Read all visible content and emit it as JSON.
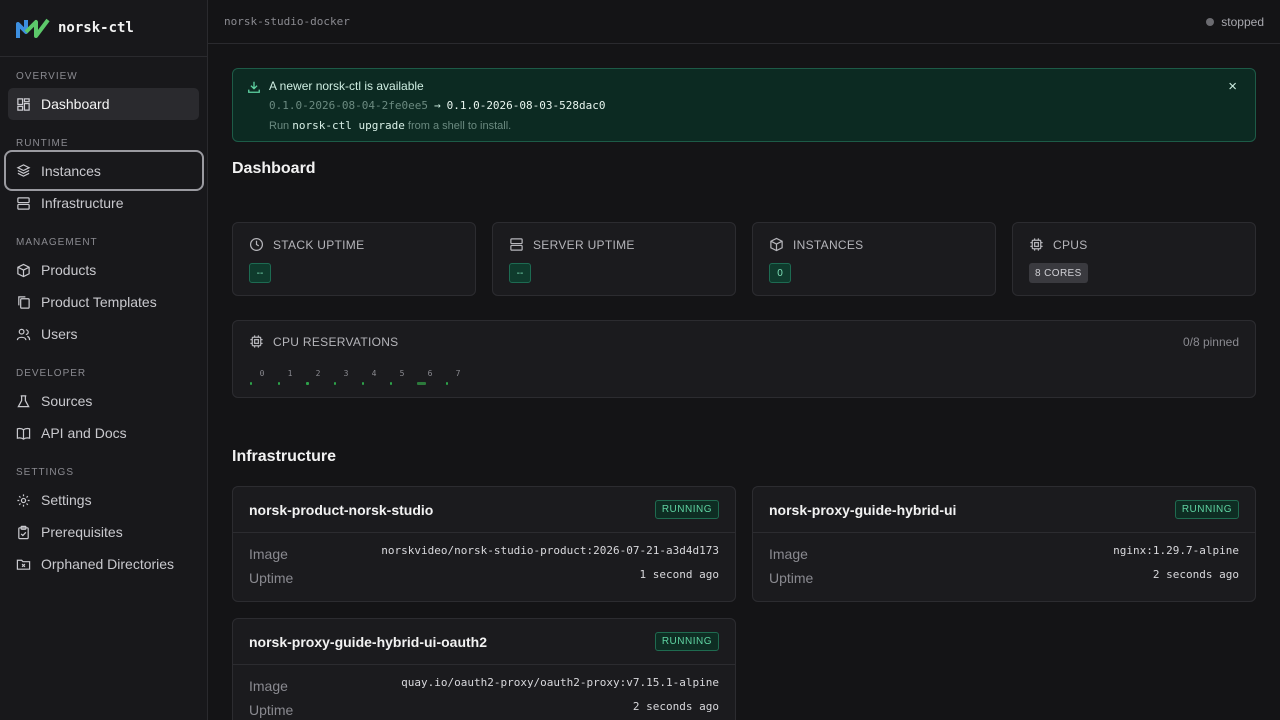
{
  "app": {
    "name": "norsk-ctl"
  },
  "topbar": {
    "title": "norsk-studio-docker",
    "status": "stopped"
  },
  "sidebar": {
    "sections": [
      "OVERVIEW",
      "RUNTIME",
      "MANAGEMENT",
      "DEVELOPER",
      "SETTINGS"
    ],
    "items": [
      {
        "label": "Dashboard",
        "icon": "dashboard-icon"
      },
      {
        "label": "Instances",
        "icon": "layers-icon"
      },
      {
        "label": "Infrastructure",
        "icon": "server-icon"
      },
      {
        "label": "Products",
        "icon": "box-icon"
      },
      {
        "label": "Product Templates",
        "icon": "copy-icon"
      },
      {
        "label": "Users",
        "icon": "users-icon"
      },
      {
        "label": "Sources",
        "icon": "flask-icon"
      },
      {
        "label": "API and Docs",
        "icon": "book-icon"
      },
      {
        "label": "Settings",
        "icon": "gear-icon"
      },
      {
        "label": "Prerequisites",
        "icon": "clipboard-check-icon"
      },
      {
        "label": "Orphaned Directories",
        "icon": "folder-x-icon"
      }
    ]
  },
  "banner": {
    "title": "A newer norsk-ctl is available",
    "current_version": "0.1.0-2026-08-04-2fe0ee5",
    "arrow": "→",
    "new_version": "0.1.0-2026-08-03-528dac0",
    "hint_prefix": "Run",
    "hint_command": "norsk-ctl upgrade",
    "hint_suffix": "from a shell to install.",
    "close": "×"
  },
  "dashboard": {
    "title": "Dashboard",
    "stats": [
      {
        "label": "STACK UPTIME",
        "value": "--",
        "icon": "clock-icon"
      },
      {
        "label": "SERVER UPTIME",
        "value": "--",
        "icon": "server-icon"
      },
      {
        "label": "INSTANCES",
        "value": "0",
        "icon": "box-icon"
      },
      {
        "label": "CPUS",
        "value": "8 CORES",
        "icon": "cpu-icon"
      }
    ],
    "cpu_reservations": {
      "label": "CPU RESERVATIONS",
      "pinned": "0/8 pinned",
      "cores": [
        "0",
        "1",
        "2",
        "3",
        "4",
        "5",
        "6",
        "7"
      ]
    }
  },
  "infrastructure": {
    "title": "Infrastructure",
    "image_label": "Image",
    "uptime_label": "Uptime",
    "items": [
      {
        "name": "norsk-product-norsk-studio",
        "status": "RUNNING",
        "image": "norskvideo/norsk-studio-product:2026-07-21-a3d4d173",
        "uptime": "1 second ago"
      },
      {
        "name": "norsk-proxy-guide-hybrid-ui",
        "status": "RUNNING",
        "image": "nginx:1.29.7-alpine",
        "uptime": "2 seconds ago"
      },
      {
        "name": "norsk-proxy-guide-hybrid-ui-oauth2",
        "status": "RUNNING",
        "image": "quay.io/oauth2-proxy/oauth2-proxy:v7.15.1-alpine",
        "uptime": "2 seconds ago"
      }
    ]
  },
  "colors": {
    "accent": "#5fd3a2",
    "banner_bg": "#0c2a22",
    "core_bar": "#2ea24a"
  }
}
